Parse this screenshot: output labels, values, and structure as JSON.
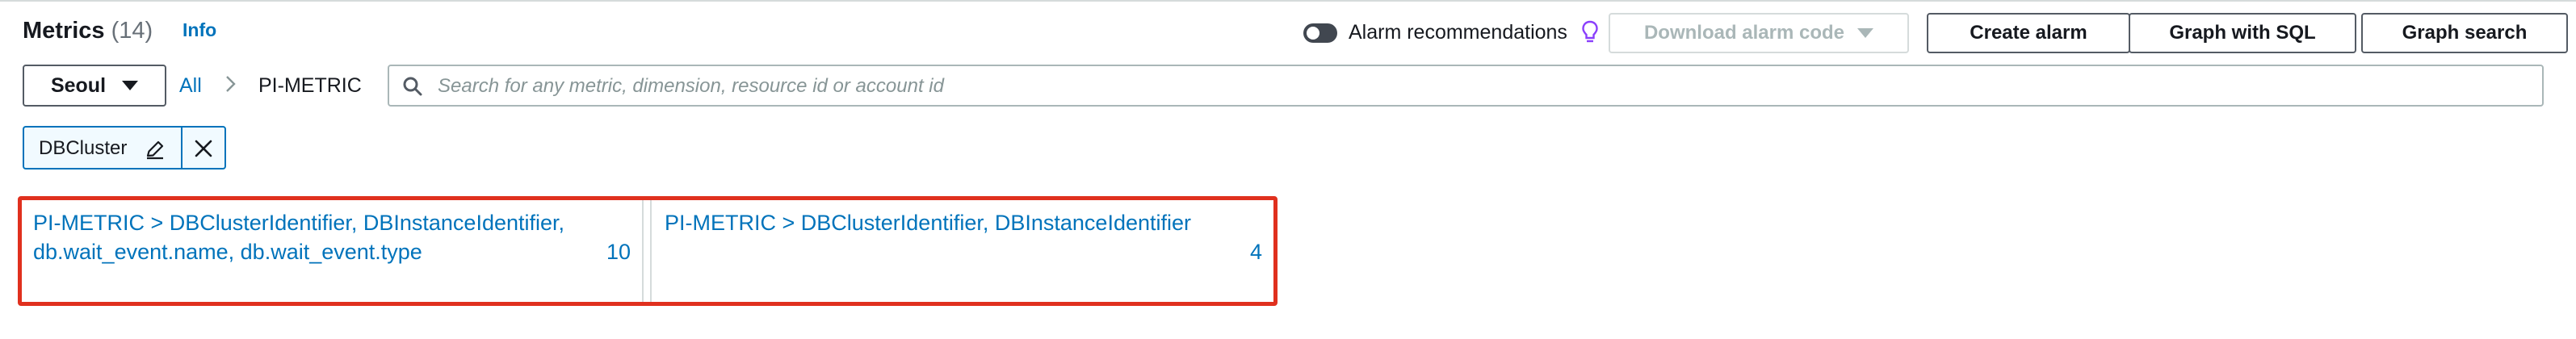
{
  "header": {
    "title": "Metrics",
    "count": "(14)",
    "info_link": "Info"
  },
  "alarm_recommendations": {
    "label": "Alarm recommendations",
    "enabled": false
  },
  "buttons": {
    "download_alarm_code": "Download alarm code",
    "create_alarm": "Create alarm",
    "graph_with_sql": "Graph with SQL",
    "graph_search": "Graph search"
  },
  "region": {
    "selected": "Seoul"
  },
  "breadcrumb": {
    "all": "All",
    "namespace": "PI-METRIC"
  },
  "search": {
    "placeholder": "Search for any metric, dimension, resource id or account id",
    "value": ""
  },
  "filter_token": {
    "label": "DBCluster"
  },
  "metric_groups": [
    {
      "title": "PI-METRIC > DBClusterIdentifier, DBInstanceIdentifier, db.wait_event.name, db.wait_event.type",
      "count": "10"
    },
    {
      "title": "PI-METRIC > DBClusterIdentifier, DBInstanceIdentifier",
      "count": "4"
    }
  ],
  "colors": {
    "link": "#0073bb",
    "highlight_border": "#e0301e",
    "token_bg": "#f1faff",
    "bulb": "#8a3ffc"
  },
  "icons": [
    "bulb-icon",
    "caret-down-icon",
    "chevron-right-icon",
    "search-icon",
    "pencil-icon",
    "close-icon"
  ]
}
